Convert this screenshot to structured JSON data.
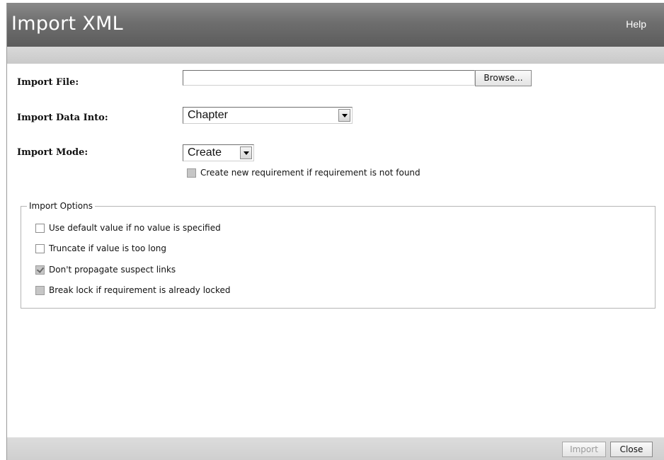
{
  "window": {
    "title": "Import XML",
    "help_label": "Help"
  },
  "form": {
    "import_file": {
      "label": "Import File:",
      "value": "",
      "browse_label": "Browse..."
    },
    "import_data_into": {
      "label": "Import Data Into:",
      "selected": "Chapter"
    },
    "import_mode": {
      "label": "Import Mode:",
      "selected": "Create",
      "create_new_requirement": {
        "label": "Create new requirement if requirement is not found",
        "checked": false,
        "enabled": false
      }
    }
  },
  "import_options": {
    "legend": "Import Options",
    "options": [
      {
        "label": "Use default value if no value is specified",
        "checked": false,
        "enabled": true
      },
      {
        "label": "Truncate if value is too long",
        "checked": false,
        "enabled": true
      },
      {
        "label": "Don't propagate suspect links",
        "checked": true,
        "enabled": false
      },
      {
        "label": "Break lock if requirement is already locked",
        "checked": false,
        "enabled": false
      }
    ]
  },
  "footer": {
    "import_label": "Import",
    "close_label": "Close"
  }
}
